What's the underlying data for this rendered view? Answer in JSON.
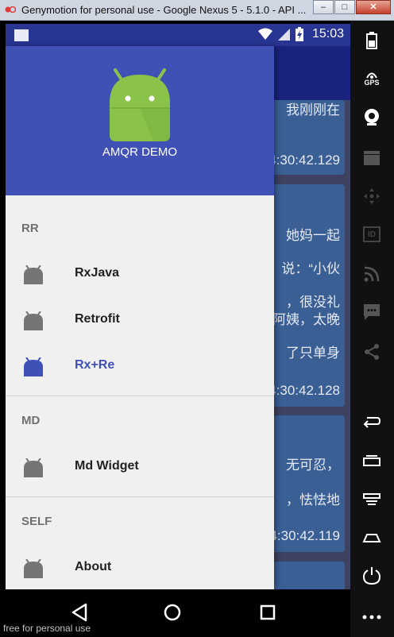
{
  "window": {
    "title": "Genymotion for personal use - Google Nexus 5 - 5.1.0 - API ...",
    "minimize_glyph": "–",
    "maximize_glyph": "□",
    "close_glyph": "✕"
  },
  "status_bar": {
    "time": "15:03",
    "notification_icon": "notification-icon",
    "icons": [
      "wifi-icon",
      "signal-icon",
      "battery-charging-icon"
    ],
    "color": "#283593"
  },
  "background_list": {
    "cards": [
      {
        "lines": [
          "我刚刚在",
          "4:30:42.129"
        ]
      },
      {
        "lines": [
          "她妈一起",
          "说：“小伙",
          "，很没礼",
          "阿姨，太晚",
          "了只单身",
          "4:30:42.128"
        ]
      },
      {
        "lines": [
          "无可忍，",
          "，怯怯地",
          "4:30:42.119"
        ]
      }
    ]
  },
  "drawer": {
    "header": {
      "title": "AMQR DEMO",
      "logo_icon": "android-logo-icon",
      "color": "#3f51b5"
    },
    "sections": [
      {
        "title": "RR",
        "items": [
          {
            "label": "RxJava",
            "icon": "android-icon",
            "selected": false
          },
          {
            "label": "Retrofit",
            "icon": "android-icon",
            "selected": false
          },
          {
            "label": "Rx+Re",
            "icon": "android-icon",
            "selected": true
          }
        ]
      },
      {
        "title": "MD",
        "items": [
          {
            "label": "Md Widget",
            "icon": "android-icon",
            "selected": false
          }
        ]
      },
      {
        "title": "SELF",
        "items": [
          {
            "label": "About",
            "icon": "android-icon",
            "selected": false
          }
        ]
      }
    ],
    "selected_color": "#3f51b5"
  },
  "nav_bar": {
    "buttons": [
      "back-icon",
      "home-icon",
      "recents-icon"
    ]
  },
  "watermark": "free for personal use",
  "side_toolbar": {
    "items": [
      "battery-icon",
      "gps-icon",
      "camera-icon",
      "video-icon",
      "dpad-icon",
      "id-icon",
      "rss-icon",
      "sms-icon",
      "share-icon",
      "back-icon",
      "recent-apps-icon",
      "menu-icon",
      "home-icon",
      "power-icon",
      "more-icon"
    ],
    "gps_label": "GPS",
    "id_label": "ID"
  }
}
